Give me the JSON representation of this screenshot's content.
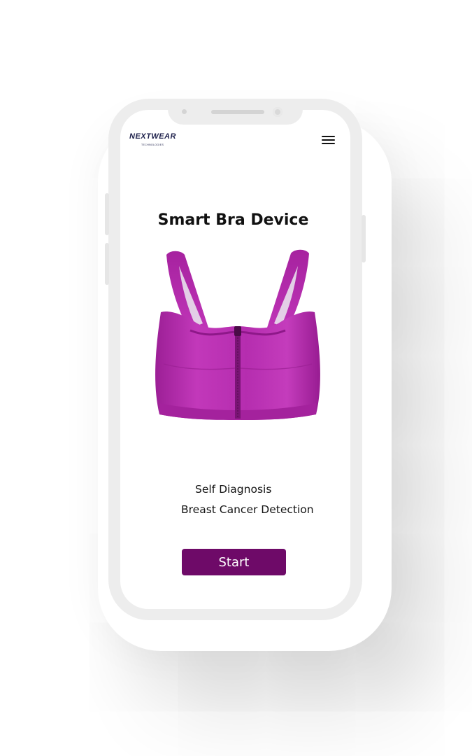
{
  "header": {
    "logo_text": "NEXTWEAR",
    "logo_subtext": "TECHNOLOGIES",
    "menu_icon": "hamburger-menu-icon"
  },
  "main": {
    "title": "Smart Bra Device",
    "product_image": "smart-bra-product",
    "features": [
      "Self Diagnosis",
      "Breast Cancer Detection"
    ],
    "start_label": "Start"
  },
  "colors": {
    "accent": "#6e0a68",
    "product": "#b02aa8",
    "logo": "#1c1f4a"
  }
}
